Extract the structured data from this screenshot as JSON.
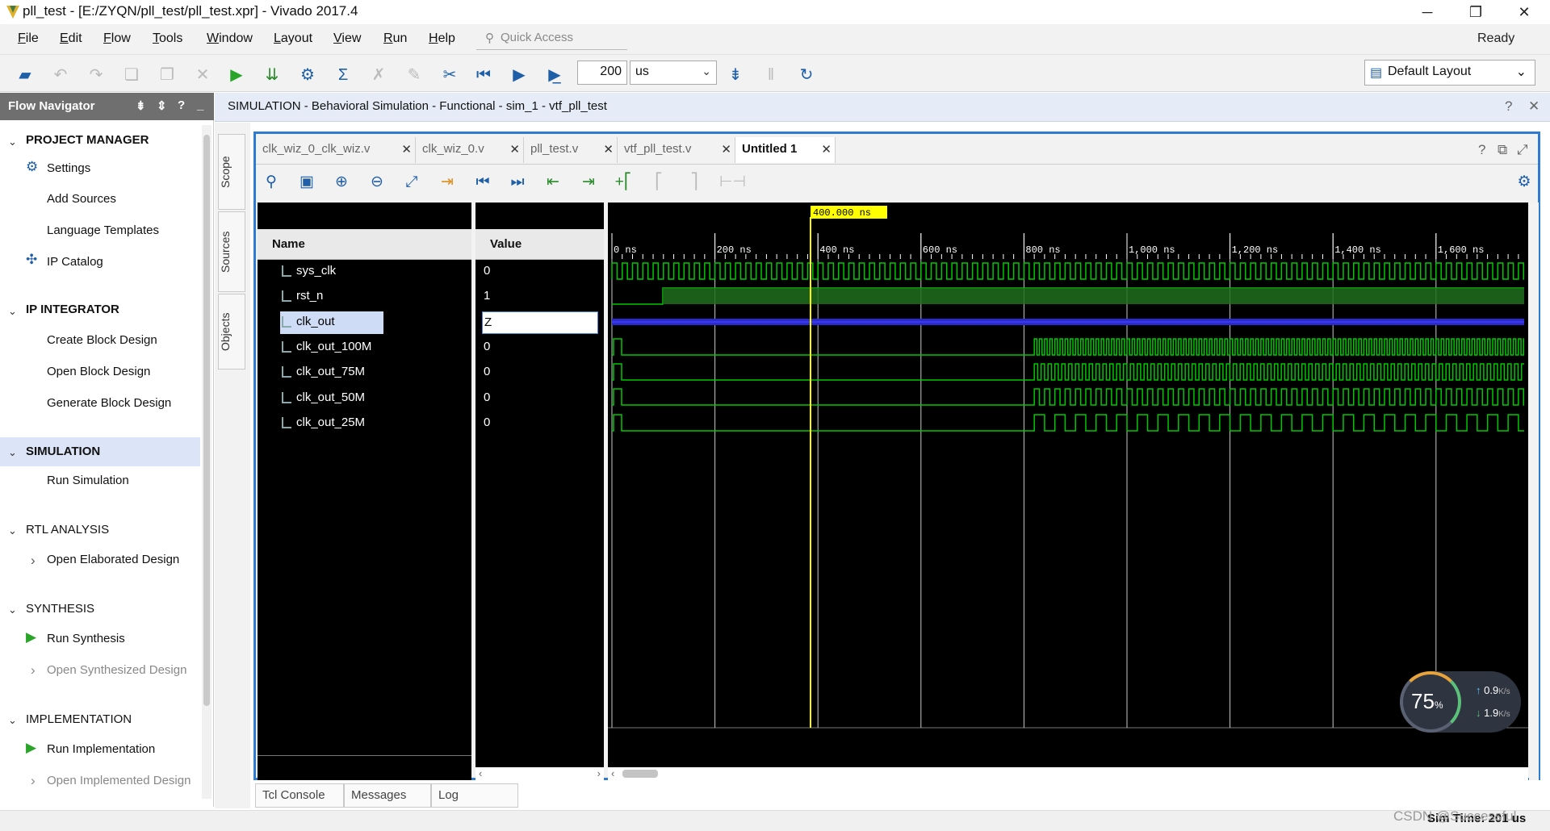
{
  "window": {
    "title": "pll_test - [E:/ZYQN/pll_test/pll_test.xpr] - Vivado 2017.4",
    "minimize_glyph": "─",
    "restore_glyph": "❐",
    "close_glyph": "✕"
  },
  "menu": [
    "File",
    "Edit",
    "Flow",
    "Tools",
    "Window",
    "Layout",
    "View",
    "Run",
    "Help"
  ],
  "quick_access": {
    "placeholder": "Quick Access",
    "icon": "search-icon"
  },
  "status": "Ready",
  "toolbar": {
    "run_time": "200",
    "run_unit": "us",
    "layout_label": "Default Layout"
  },
  "flow_navigator": {
    "title": "Flow Navigator",
    "sections": [
      {
        "title": "PROJECT MANAGER",
        "items": [
          "Settings",
          "Add Sources",
          "Language Templates",
          "IP Catalog"
        ]
      },
      {
        "title": "IP INTEGRATOR",
        "items": [
          "Create Block Design",
          "Open Block Design",
          "Generate Block Design"
        ]
      },
      {
        "title": "SIMULATION",
        "items": [
          "Run Simulation"
        ]
      },
      {
        "title": "RTL ANALYSIS",
        "items": [
          "Open Elaborated Design"
        ]
      },
      {
        "title": "SYNTHESIS",
        "items": [
          "Run Synthesis",
          "Open Synthesized Design"
        ]
      },
      {
        "title": "IMPLEMENTATION",
        "items": [
          "Run Implementation",
          "Open Implemented Design"
        ]
      }
    ]
  },
  "sim_header": "SIMULATION - Behavioral Simulation - Functional - sim_1 - vtf_pll_test",
  "side_tabs": [
    "Scope",
    "Sources",
    "Objects"
  ],
  "file_tabs": [
    "clk_wiz_0_clk_wiz.v",
    "clk_wiz_0.v",
    "pll_test.v",
    "vtf_pll_test.v",
    "Untitled 1"
  ],
  "wave": {
    "name_header": "Name",
    "value_header": "Value",
    "cursor_label": "400.000 ns",
    "ruler_labels": [
      "0 ns",
      "200 ns",
      "400 ns",
      "600 ns",
      "800 ns",
      "1,000 ns",
      "1,200 ns",
      "1,400 ns",
      "1,600 ns"
    ],
    "signals": [
      {
        "name": "sys_clk",
        "value": "0"
      },
      {
        "name": "rst_n",
        "value": "1"
      },
      {
        "name": "clk_out",
        "value": "Z"
      },
      {
        "name": "clk_out_100M",
        "value": "0"
      },
      {
        "name": "clk_out_75M",
        "value": "0"
      },
      {
        "name": "clk_out_50M",
        "value": "0"
      },
      {
        "name": "clk_out_25M",
        "value": "0"
      }
    ]
  },
  "bottom_tabs": [
    "Tcl Console",
    "Messages",
    "Log"
  ],
  "sim_time": "Sim Time: 201 us",
  "watermark": "CSDN @Successful",
  "net_meter": {
    "percent": "75",
    "unit": "%",
    "up": "0.9",
    "down": "1.9",
    "rate_unit": "K/s"
  },
  "colors": {
    "accent": "#2f7bd1",
    "wave": "#00c800",
    "cursor": "#ffff00",
    "highz": "#2a2ad0"
  }
}
